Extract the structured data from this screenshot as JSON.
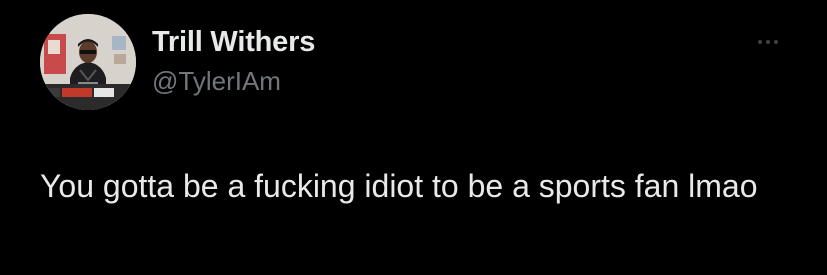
{
  "tweet": {
    "author": {
      "display_name": "Trill Withers",
      "handle": "@TylerIAm",
      "avatar_icon": "profile-photo"
    },
    "text": "You gotta be a fucking idiot to be a sports fan lmao",
    "more_icon": "more-horizontal-icon"
  },
  "colors": {
    "background": "#000000",
    "primary_text": "#e7e9ea",
    "secondary_text": "#71767b",
    "more_dots": "#3e4144"
  }
}
